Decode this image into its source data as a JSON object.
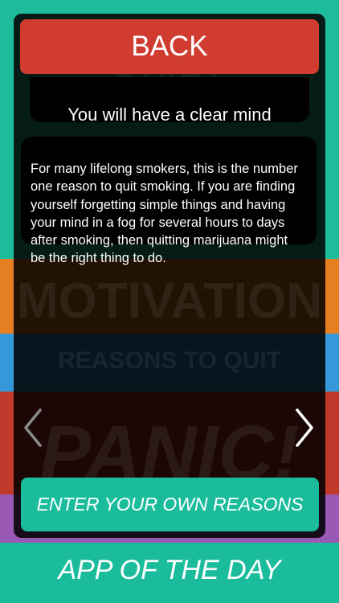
{
  "colors": {
    "back_button": "#d03d30",
    "accent_teal": "#1abc9c",
    "band_orange": "#e67e22",
    "band_blue": "#3498db",
    "band_red": "#c0392b",
    "band_purple": "#9b59b6",
    "text": "#ffffff"
  },
  "header": {
    "back_label": "BACK"
  },
  "background_menu": {
    "start_label": "START",
    "suffix_label": "TE",
    "motivation_label": "MOTIVATION",
    "reasons_label": "REASONS TO QUIT",
    "panic_label": "PANIC!"
  },
  "reason": {
    "title": "You will have a clear mind",
    "body": "For many lifelong smokers, this is the number one reason to quit smoking. If you are finding yourself forgetting simple things and having your mind in a fog for several hours to days after smoking, then quitting marijuana might be the right thing to do."
  },
  "navigation": {
    "previous_icon": "chevron-left-icon",
    "next_icon": "chevron-right-icon"
  },
  "actions": {
    "enter_reasons_label": "ENTER YOUR OWN REASONS"
  },
  "footer": {
    "label": "APP OF THE DAY"
  }
}
